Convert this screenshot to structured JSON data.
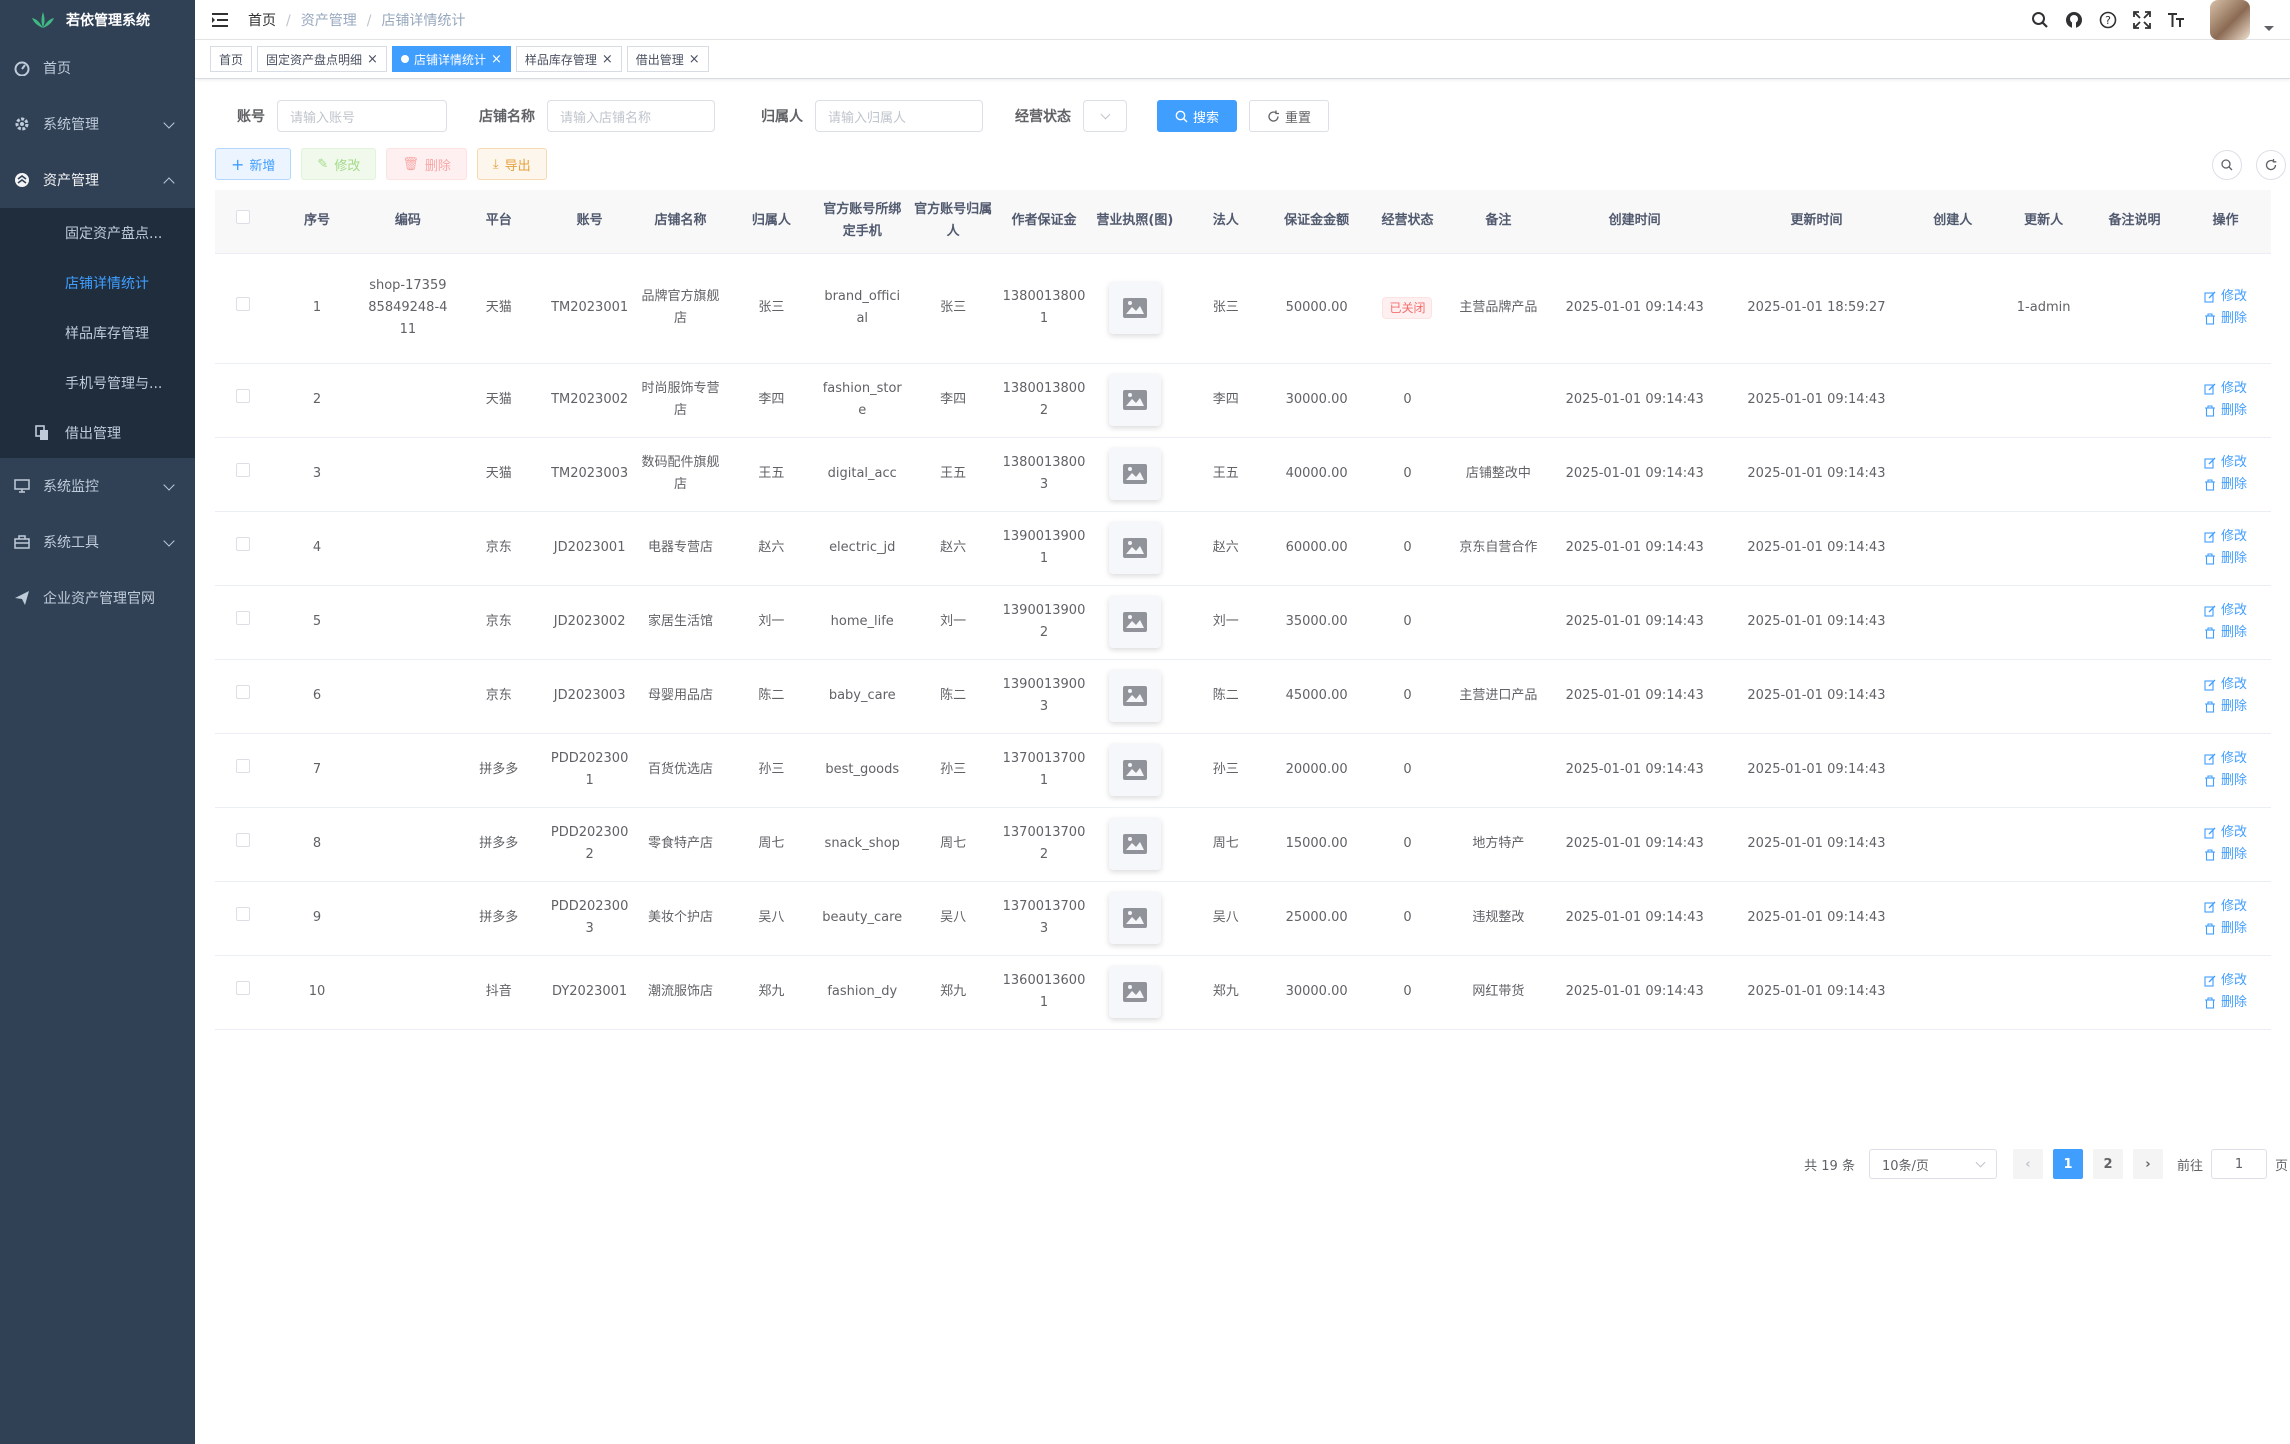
{
  "app": {
    "title": "若依管理系统"
  },
  "sidebar": {
    "items": [
      {
        "label": "首页",
        "icon": "dashboard-icon"
      },
      {
        "label": "系统管理",
        "icon": "gear-icon"
      },
      {
        "label": "资产管理",
        "icon": "asset-icon"
      }
    ],
    "sub_items": [
      {
        "label": "固定资产盘点..."
      },
      {
        "label": "店铺详情统计"
      },
      {
        "label": "样品库存管理"
      },
      {
        "label": "手机号管理与..."
      },
      {
        "label": "借出管理"
      }
    ],
    "bottom_items": [
      {
        "label": "系统监控"
      },
      {
        "label": "系统工具"
      },
      {
        "label": "企业资产管理官网"
      }
    ]
  },
  "breadcrumb": [
    "首页",
    "资产管理",
    "店铺详情统计"
  ],
  "tags": [
    "首页",
    "固定资产盘点明细",
    "店铺详情统计",
    "样品库存管理",
    "借出管理"
  ],
  "search": {
    "account_label": "账号",
    "account_placeholder": "请输入账号",
    "shop_label": "店铺名称",
    "shop_placeholder": "请输入店铺名称",
    "owner_label": "归属人",
    "owner_placeholder": "请输入归属人",
    "status_label": "经营状态",
    "search_btn": "搜索",
    "reset_btn": "重置"
  },
  "toolbar": {
    "add": "新增",
    "edit": "修改",
    "delete": "删除",
    "export": "导出"
  },
  "columns": [
    "序号",
    "编码",
    "平台",
    "账号",
    "店铺名称",
    "归属人",
    "官方账号所绑定手机",
    "官方账号归属人",
    "作者保证金",
    "营业执照(图)",
    "法人",
    "保证金金额",
    "经营状态",
    "备注",
    "创建时间",
    "更新时间",
    "创建人",
    "更新人",
    "备注说明",
    "操作"
  ],
  "rows": [
    {
      "idx": "1",
      "code": "shop-1735985849248-411",
      "platform": "天猫",
      "account": "TM2023001",
      "shop": "品牌官方旗舰店",
      "owner": "张三",
      "phone_bind": "brand_official",
      "acct_owner": "张三",
      "deposit": "13800138001",
      "legal": "张三",
      "amount": "50000.00",
      "status": "已关闭",
      "remark": "主营品牌产品",
      "created": "2025-01-01 09:14:43",
      "updated": "2025-01-01 18:59:27",
      "creator": "",
      "updater": "1-admin",
      "note": ""
    },
    {
      "idx": "2",
      "code": "",
      "platform": "天猫",
      "account": "TM2023002",
      "shop": "时尚服饰专营店",
      "owner": "李四",
      "phone_bind": "fashion_store",
      "acct_owner": "李四",
      "deposit": "13800138002",
      "legal": "李四",
      "amount": "30000.00",
      "status": "0",
      "remark": "",
      "created": "2025-01-01 09:14:43",
      "updated": "2025-01-01 09:14:43",
      "creator": "",
      "updater": "",
      "note": ""
    },
    {
      "idx": "3",
      "code": "",
      "platform": "天猫",
      "account": "TM2023003",
      "shop": "数码配件旗舰店",
      "owner": "王五",
      "phone_bind": "digital_acc",
      "acct_owner": "王五",
      "deposit": "13800138003",
      "legal": "王五",
      "amount": "40000.00",
      "status": "0",
      "remark": "店铺整改中",
      "created": "2025-01-01 09:14:43",
      "updated": "2025-01-01 09:14:43",
      "creator": "",
      "updater": "",
      "note": ""
    },
    {
      "idx": "4",
      "code": "",
      "platform": "京东",
      "account": "JD2023001",
      "shop": "电器专营店",
      "owner": "赵六",
      "phone_bind": "electric_jd",
      "acct_owner": "赵六",
      "deposit": "13900139001",
      "legal": "赵六",
      "amount": "60000.00",
      "status": "0",
      "remark": "京东自营合作",
      "created": "2025-01-01 09:14:43",
      "updated": "2025-01-01 09:14:43",
      "creator": "",
      "updater": "",
      "note": ""
    },
    {
      "idx": "5",
      "code": "",
      "platform": "京东",
      "account": "JD2023002",
      "shop": "家居生活馆",
      "owner": "刘一",
      "phone_bind": "home_life",
      "acct_owner": "刘一",
      "deposit": "13900139002",
      "legal": "刘一",
      "amount": "35000.00",
      "status": "0",
      "remark": "",
      "created": "2025-01-01 09:14:43",
      "updated": "2025-01-01 09:14:43",
      "creator": "",
      "updater": "",
      "note": ""
    },
    {
      "idx": "6",
      "code": "",
      "platform": "京东",
      "account": "JD2023003",
      "shop": "母婴用品店",
      "owner": "陈二",
      "phone_bind": "baby_care",
      "acct_owner": "陈二",
      "deposit": "13900139003",
      "legal": "陈二",
      "amount": "45000.00",
      "status": "0",
      "remark": "主营进口产品",
      "created": "2025-01-01 09:14:43",
      "updated": "2025-01-01 09:14:43",
      "creator": "",
      "updater": "",
      "note": ""
    },
    {
      "idx": "7",
      "code": "",
      "platform": "拼多多",
      "account": "PDD2023001",
      "shop": "百货优选店",
      "owner": "孙三",
      "phone_bind": "best_goods",
      "acct_owner": "孙三",
      "deposit": "13700137001",
      "legal": "孙三",
      "amount": "20000.00",
      "status": "0",
      "remark": "",
      "created": "2025-01-01 09:14:43",
      "updated": "2025-01-01 09:14:43",
      "creator": "",
      "updater": "",
      "note": ""
    },
    {
      "idx": "8",
      "code": "",
      "platform": "拼多多",
      "account": "PDD2023002",
      "shop": "零食特产店",
      "owner": "周七",
      "phone_bind": "snack_shop",
      "acct_owner": "周七",
      "deposit": "13700137002",
      "legal": "周七",
      "amount": "15000.00",
      "status": "0",
      "remark": "地方特产",
      "created": "2025-01-01 09:14:43",
      "updated": "2025-01-01 09:14:43",
      "creator": "",
      "updater": "",
      "note": ""
    },
    {
      "idx": "9",
      "code": "",
      "platform": "拼多多",
      "account": "PDD2023003",
      "shop": "美妆个护店",
      "owner": "吴八",
      "phone_bind": "beauty_care",
      "acct_owner": "吴八",
      "deposit": "13700137003",
      "legal": "吴八",
      "amount": "25000.00",
      "status": "0",
      "remark": "违规整改",
      "created": "2025-01-01 09:14:43",
      "updated": "2025-01-01 09:14:43",
      "creator": "",
      "updater": "",
      "note": ""
    },
    {
      "idx": "10",
      "code": "",
      "platform": "抖音",
      "account": "DY2023001",
      "shop": "潮流服饰店",
      "owner": "郑九",
      "phone_bind": "fashion_dy",
      "acct_owner": "郑九",
      "deposit": "13600136001",
      "legal": "郑九",
      "amount": "30000.00",
      "status": "0",
      "remark": "网红带货",
      "created": "2025-01-01 09:14:43",
      "updated": "2025-01-01 09:14:43",
      "creator": "",
      "updater": "",
      "note": ""
    }
  ],
  "ops": {
    "edit": "修改",
    "delete": "删除"
  },
  "pagination": {
    "total": "共 19 条",
    "page_size": "10条/页",
    "pages": [
      "1",
      "2"
    ],
    "goto_label": "前往",
    "goto_value": "1",
    "goto_unit": "页"
  },
  "colors": {
    "sidebar": "#304156",
    "accent": "#409eff"
  }
}
